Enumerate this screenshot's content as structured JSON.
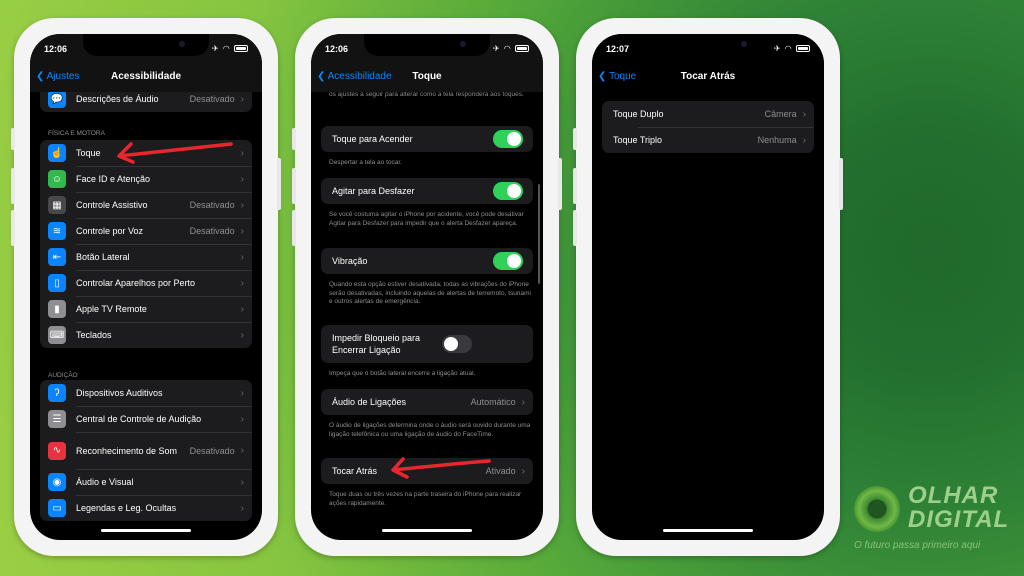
{
  "colors": {
    "accent": "#0a84ff",
    "toggle_on": "#30d158",
    "arrow": "#e8262d"
  },
  "phones": [
    {
      "time": "12:06",
      "back": "Ajustes",
      "title": "Acessibilidade",
      "top_card": [
        {
          "label": "Descrições de Áudio",
          "value": "Desativado",
          "icon": "audio-description-icon",
          "color": "#0a84ff",
          "glyph": "💬"
        }
      ],
      "sections": [
        {
          "header": "FÍSICA E MOTORA",
          "items": [
            {
              "label": "Toque",
              "value": "",
              "icon": "touch-hand-icon",
              "color": "#0a84ff",
              "glyph": "☝"
            },
            {
              "label": "Face ID e Atenção",
              "value": "",
              "icon": "face-id-icon",
              "color": "#30b94d",
              "glyph": "☺"
            },
            {
              "label": "Controle Assistivo",
              "value": "Desativado",
              "icon": "switch-control-icon",
              "color": "#48484a",
              "glyph": "▦"
            },
            {
              "label": "Controle por Voz",
              "value": "Desativado",
              "icon": "voice-control-icon",
              "color": "#0a84ff",
              "glyph": "≋"
            },
            {
              "label": "Botão Lateral",
              "value": "",
              "icon": "side-button-icon",
              "color": "#0a84ff",
              "glyph": "⇤"
            },
            {
              "label": "Controlar Aparelhos por Perto",
              "value": "",
              "icon": "nearby-devices-icon",
              "color": "#0a84ff",
              "glyph": "▯"
            },
            {
              "label": "Apple TV Remote",
              "value": "",
              "icon": "tv-remote-icon",
              "color": "#8e8e93",
              "glyph": "▮"
            },
            {
              "label": "Teclados",
              "value": "",
              "icon": "keyboard-icon",
              "color": "#8e8e93",
              "glyph": "⌨"
            }
          ]
        },
        {
          "header": "AUDIÇÃO",
          "items": [
            {
              "label": "Dispositivos Auditivos",
              "value": "",
              "icon": "ear-icon",
              "color": "#0a84ff",
              "glyph": "ʔ"
            },
            {
              "label": "Central de Controle de Audição",
              "value": "",
              "icon": "control-center-icon",
              "color": "#8e8e93",
              "glyph": "☰"
            },
            {
              "label": "Reconhecimento de Som",
              "value": "Desativado",
              "icon": "sound-recognition-icon",
              "color": "#e5343f",
              "glyph": "∿"
            },
            {
              "label": "Áudio e Visual",
              "value": "",
              "icon": "audio-visual-icon",
              "color": "#0a84ff",
              "glyph": "◉"
            },
            {
              "label": "Legendas e Leg. Ocultas",
              "value": "",
              "icon": "captions-icon",
              "color": "#0a84ff",
              "glyph": "▭"
            }
          ]
        }
      ]
    },
    {
      "time": "12:06",
      "back": "Acessibilidade",
      "title": "Toque",
      "intro": "Se você tiver dificuldades para usar a tela sensível ao toque, configure os ajustes a seguir para alterar como a tela responderá aos toques.",
      "items": [
        {
          "label": "Toque para Acender",
          "toggle": true,
          "footer": "Despertar a tela ao tocar."
        },
        {
          "label": "Agitar para Desfazer",
          "toggle": true,
          "footer": "Se você costuma agitar o iPhone por acidente, você pode desativar Agitar para Desfazer para impedir que o alerta Desfazer apareça."
        },
        {
          "label": "Vibração",
          "toggle": true,
          "footer": "Quando esta opção estiver desativada, todas as vibrações do iPhone serão desativadas, incluindo aquelas de alertas de terremoto, tsunami e outros alertas de emergência."
        },
        {
          "label": "Impedir Bloqueio para Encerrar Ligação",
          "toggle": false,
          "footer": "Impeça que o botão lateral encerre a ligação atual."
        },
        {
          "label": "Áudio de Ligações",
          "value": "Automático",
          "footer": "O áudio de ligações determina onde o áudio será ouvido durante uma ligação telefônica ou uma ligação de áudio do FaceTime."
        },
        {
          "label": "Tocar Atrás",
          "value": "Ativado",
          "footer": "Toque duas ou três vezes na parte traseira do iPhone para realizar ações rapidamente."
        }
      ]
    },
    {
      "time": "12:07",
      "back": "Toque",
      "title": "Tocar Atrás",
      "items": [
        {
          "label": "Toque Duplo",
          "value": "Câmera"
        },
        {
          "label": "Toque Triplo",
          "value": "Nenhuma"
        }
      ]
    }
  ],
  "brand": {
    "name_line1": "OLHAR",
    "name_line2": "DIGITAL",
    "tagline": "O futuro passa primeiro aqui"
  }
}
